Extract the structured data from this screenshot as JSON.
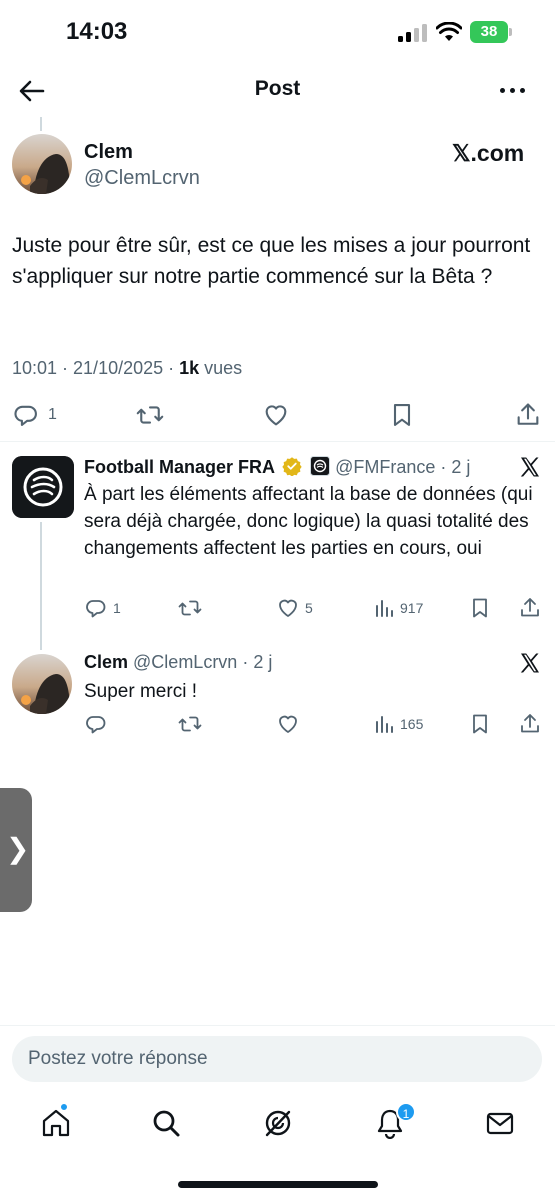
{
  "status_bar": {
    "time": "14:03",
    "battery": "38"
  },
  "nav": {
    "title": "Post"
  },
  "main_post": {
    "name": "Clem",
    "handle": "@ClemLcrvn",
    "source": "𝕏.com",
    "text": "Juste pour être sûr, est ce que les mises a jour pourront s'appliquer sur notre partie commencé sur la Bêta ?",
    "time": "10:01 · 21/10/2025 · ",
    "views_count": "1k",
    "views_label": " vues",
    "replies": "1"
  },
  "reply1": {
    "name": "Football Manager FRA",
    "handle": "@FMFrance · 2 j",
    "text": "À part les éléments affectant la base de données (qui sera déjà chargée, donc logique) la quasi totalité des changements affectent les parties en cours, oui",
    "replies": "1",
    "likes": "5",
    "views": "917"
  },
  "reply2": {
    "name": "Clem",
    "handle": "@ClemLcrvn · 2 j",
    "text": "Super merci !",
    "views": "165"
  },
  "side_tab": {
    "glyph": "❯"
  },
  "compose": {
    "placeholder": "Postez votre réponse"
  },
  "tabbar": {
    "notifications_badge": "1"
  },
  "colors": {
    "accent": "#1d9bf0",
    "text": "#0f1419",
    "muted": "#536471",
    "verified_gold": "#e2b719",
    "battery": "#34c759"
  },
  "icons": [
    "back-arrow-icon",
    "more-icon",
    "reply-icon",
    "repost-icon",
    "like-icon",
    "bookmark-icon",
    "share-icon",
    "views-icon",
    "x-logo-icon",
    "verified-badge-icon",
    "home-icon",
    "search-icon",
    "grok-icon",
    "notifications-icon",
    "messages-icon"
  ]
}
